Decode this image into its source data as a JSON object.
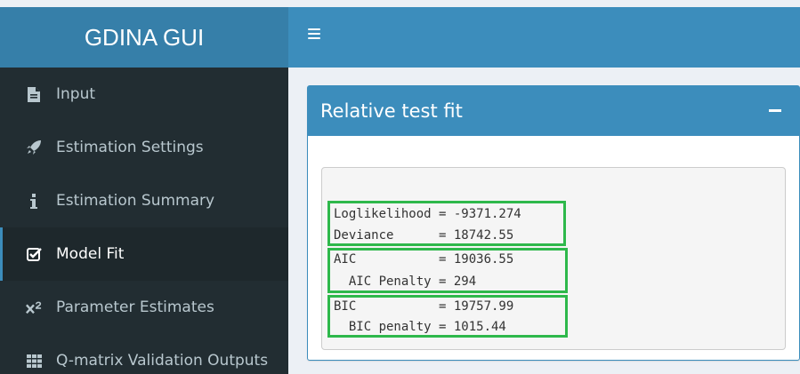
{
  "app": {
    "title": "GDINA GUI"
  },
  "navbar": {
    "toggle_icon": "hamburger-icon"
  },
  "sidebar": {
    "items": [
      {
        "label": "Input",
        "icon": "file-icon",
        "active": false
      },
      {
        "label": "Estimation Settings",
        "icon": "rocket-icon",
        "active": false
      },
      {
        "label": "Estimation Summary",
        "icon": "info-icon",
        "active": false
      },
      {
        "label": "Model Fit",
        "icon": "check-square-icon",
        "active": true
      },
      {
        "label": "Parameter Estimates",
        "icon": "x-squared-icon",
        "active": false
      },
      {
        "label": "Q-matrix Validation Outputs",
        "icon": "table-icon",
        "active": false
      }
    ]
  },
  "box": {
    "title": "Relative test fit",
    "lines": [
      "Loglikelihood = -9371.274",
      "Deviance      = 18742.55",
      "AIC           = 19036.55",
      "  AIC Penalty = 294",
      "BIC           = 19757.99",
      "  BIC penalty = 1015.44"
    ]
  },
  "colors": {
    "header": "#3c8dbc",
    "logo": "#367fa9",
    "sidebar": "#222d32",
    "sidebar_active": "#1e282c",
    "highlight": "#2eb84b"
  }
}
